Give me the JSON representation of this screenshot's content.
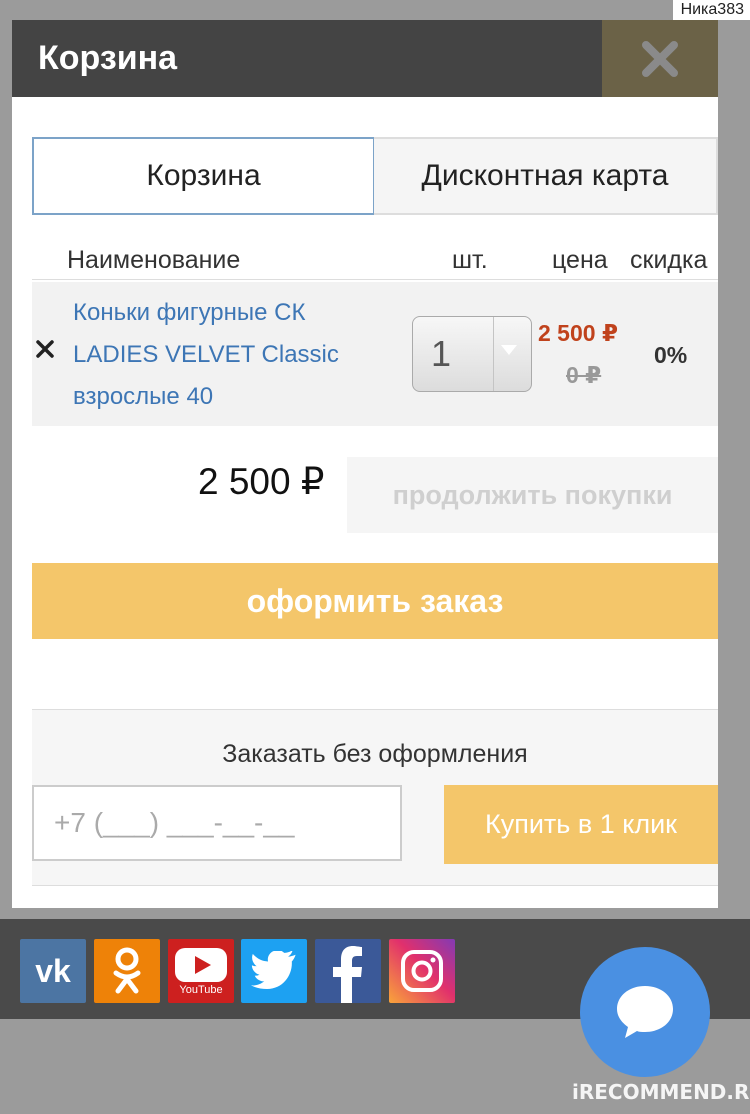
{
  "user": {
    "name": "Ника383"
  },
  "modal": {
    "title": "Корзина"
  },
  "tabs": [
    {
      "label": "Корзина",
      "active": true
    },
    {
      "label": "Дисконтная карта",
      "active": false
    }
  ],
  "table": {
    "headers": {
      "name": "Наименование",
      "qty": "шт.",
      "price": "цена",
      "discount": "скидка"
    },
    "items": [
      {
        "name": "Коньки фигурные СК LADIES VELVET Classic взрослые 40",
        "qty": "1",
        "price": "2 500 ₽",
        "old_price": "0 ₽",
        "discount": "0%"
      }
    ]
  },
  "summary": {
    "total": "2 500 ₽",
    "continue_label": "продолжить покупки",
    "order_label": "оформить заказ"
  },
  "quick_order": {
    "title": "Заказать без оформления",
    "phone_placeholder": "+7 (___) ___-__-__",
    "button_label": "Купить в 1 клик"
  },
  "social": [
    "vk-icon",
    "odnoklassniki-icon",
    "youtube-icon",
    "twitter-icon",
    "facebook-icon",
    "instagram-icon"
  ],
  "youtube_caption": "YouTube",
  "watermark": "iRECOMMEND.RU",
  "colors": {
    "header_bg": "#444444",
    "accent_yellow": "#f4c66a",
    "link_blue": "#3d76b5",
    "price_red": "#c0421c",
    "chat_blue": "#4a90e2"
  }
}
